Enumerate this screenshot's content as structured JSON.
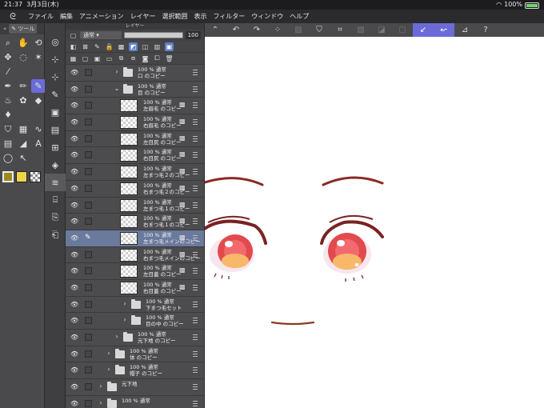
{
  "status": {
    "time": "21:37",
    "date": "3月3日(木)",
    "battery": "100%"
  },
  "menu": [
    "ファイル",
    "編集",
    "アニメーション",
    "レイヤー",
    "選択範囲",
    "表示",
    "フィルター",
    "ウィンドウ",
    "ヘルプ"
  ],
  "tool_palette": {
    "title": "ツール"
  },
  "colors": {
    "accent": "#6b6bd8",
    "main_color": "#9a8a20",
    "sub_color": "#f0d44a"
  },
  "layer_panel": {
    "title": "レイヤー",
    "blend_mode": "通常",
    "opacity": "100",
    "layers": [
      {
        "kind": "folder",
        "indent": 1,
        "expanded": false,
        "blend": "100 % 通常",
        "name": "口 のコピー"
      },
      {
        "kind": "folder",
        "indent": 1,
        "expanded": true,
        "blend": "100 % 通常",
        "name": "目 のコピー"
      },
      {
        "kind": "raster",
        "indent": 2,
        "blend": "100 % 通常",
        "name": "左眉毛 のコピー"
      },
      {
        "kind": "raster",
        "indent": 2,
        "blend": "100 % 通常",
        "name": "右眉毛 のコピー"
      },
      {
        "kind": "raster",
        "indent": 2,
        "blend": "100 % 通常",
        "name": "左目尻 のコピー"
      },
      {
        "kind": "raster",
        "indent": 2,
        "blend": "100 % 通常",
        "name": "右目尻 のコピー"
      },
      {
        "kind": "raster",
        "indent": 2,
        "blend": "100 % 通常",
        "name": "左まつ毛２のコピー"
      },
      {
        "kind": "raster",
        "indent": 2,
        "blend": "100 % 通常",
        "name": "右まつ毛２のコピー"
      },
      {
        "kind": "raster",
        "indent": 2,
        "blend": "100 % 通常",
        "name": "左まつ毛１のコピー"
      },
      {
        "kind": "raster",
        "indent": 2,
        "blend": "100 % 通常",
        "name": "右まつ毛１のコピー"
      },
      {
        "kind": "raster",
        "indent": 2,
        "selected": true,
        "blend": "100 % 通常",
        "name": "左まつ毛メインのコピー"
      },
      {
        "kind": "raster",
        "indent": 2,
        "blend": "100 % 通常",
        "name": "右まつ毛メインのコピー"
      },
      {
        "kind": "raster",
        "indent": 2,
        "blend": "100 % 通常",
        "name": "左目蓋 のコピー"
      },
      {
        "kind": "raster",
        "indent": 2,
        "blend": "100 % 通常",
        "name": "右目蓋 のコピー"
      },
      {
        "kind": "folder",
        "indent": 2,
        "expanded": false,
        "blend": "100 % 通常",
        "name": "下まつ毛セット"
      },
      {
        "kind": "folder",
        "indent": 2,
        "expanded": false,
        "blend": "100 % 通常",
        "name": "目の中 のコピー"
      },
      {
        "kind": "folder",
        "indent": 1,
        "expanded": false,
        "blend": "100 % 通常",
        "name": "元下地 のコピー"
      },
      {
        "kind": "folder",
        "indent": 0,
        "expanded": false,
        "blend": "100 % 通常",
        "name": "体 のコピー"
      },
      {
        "kind": "folder",
        "indent": 0,
        "expanded": false,
        "blend": "100 % 通常",
        "name": "帽子 のコピー"
      },
      {
        "kind": "folder",
        "indent": -1,
        "expanded": false,
        "blend": "",
        "name": "元下地"
      },
      {
        "kind": "folder",
        "indent": -1,
        "expanded": false,
        "blend": "100 % 通常",
        "name": ""
      }
    ]
  }
}
